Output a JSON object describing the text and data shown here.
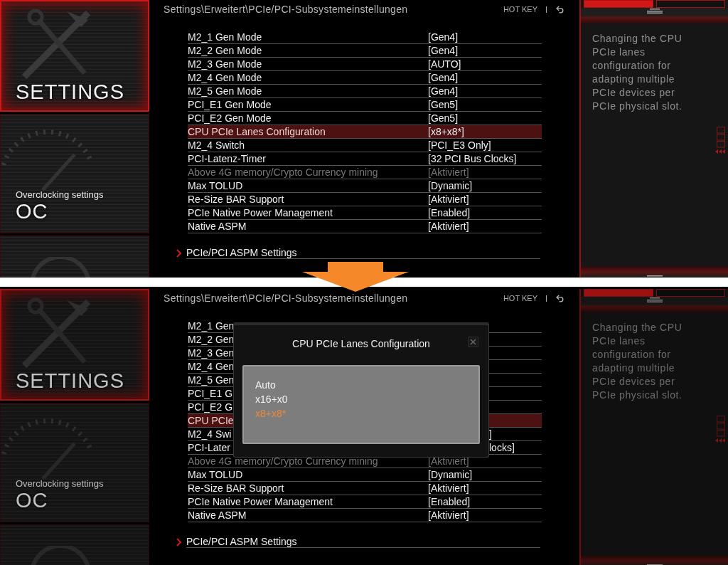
{
  "panels": [
    {
      "dimmed": false,
      "breadcrumb": "Settings\\Erweitert\\PCIe/PCI-Subsystemeinstellungen",
      "hotkey": "HOT KEY",
      "sidebar": [
        {
          "kind": "settings",
          "title": "SETTINGS",
          "selected": true
        },
        {
          "kind": "oc",
          "subtitle": "Overclocking settings",
          "title": "OC",
          "selected": false
        },
        {
          "kind": "blank",
          "selected": false
        }
      ],
      "help_tabs": [
        {
          "selected": true
        },
        {
          "selected": false
        }
      ],
      "help_text": "Changing the CPU\nPCIe lanes\nconfiguration for\nadapting multiple\nPCIe devices per\nPCIe physical slot.",
      "rows": [
        {
          "label": "M2_1 Gen Mode",
          "value": "[Gen4]",
          "selected": false,
          "disabled": false
        },
        {
          "label": "M2_2 Gen Mode",
          "value": "[Gen4]",
          "selected": false,
          "disabled": false
        },
        {
          "label": "M2_3 Gen Mode",
          "value": "[AUTO]",
          "selected": false,
          "disabled": false
        },
        {
          "label": "M2_4 Gen Mode",
          "value": "[Gen4]",
          "selected": false,
          "disabled": false
        },
        {
          "label": "M2_5 Gen Mode",
          "value": "[Gen4]",
          "selected": false,
          "disabled": false
        },
        {
          "label": "PCI_E1 Gen Mode",
          "value": "[Gen5]",
          "selected": false,
          "disabled": false
        },
        {
          "label": "PCI_E2 Gen Mode",
          "value": "[Gen5]",
          "selected": false,
          "disabled": false
        },
        {
          "label": "CPU PCIe Lanes Configuration",
          "value": "[x8+x8*]",
          "selected": true,
          "disabled": false
        },
        {
          "label": "M2_4 Switch",
          "value": "[PCI_E3 Only]",
          "selected": false,
          "disabled": false
        },
        {
          "label": "PCI-Latenz-Timer",
          "value": "[32 PCI Bus Clocks]",
          "selected": false,
          "disabled": false
        },
        {
          "label": "Above 4G memory/Crypto Currency mining",
          "value": "[Aktiviert]",
          "selected": false,
          "disabled": true
        },
        {
          "label": "Max TOLUD",
          "value": "[Dynamic]",
          "selected": false,
          "disabled": false
        },
        {
          "label": "Re-Size BAR Support",
          "value": "[Aktiviert]",
          "selected": false,
          "disabled": false
        },
        {
          "label": "PCIe Native Power Management",
          "value": "[Enabled]",
          "selected": false,
          "disabled": false
        },
        {
          "label": "Native ASPM",
          "value": "[Aktiviert]",
          "selected": false,
          "disabled": false
        }
      ],
      "submenu": "PCIe/PCI ASPM Settings"
    },
    {
      "dimmed": true,
      "breadcrumb": "Settings\\Erweitert\\PCIe/PCI-Subsystemeinstellungen",
      "hotkey": "HOT KEY",
      "sidebar": [
        {
          "kind": "settings",
          "title": "SETTINGS",
          "selected": true
        },
        {
          "kind": "oc",
          "subtitle": "Overclocking settings",
          "title": "OC",
          "selected": false
        },
        {
          "kind": "blank",
          "selected": false
        }
      ],
      "help_tabs": [
        {
          "selected": true
        },
        {
          "selected": false
        }
      ],
      "help_text": "Changing the CPU\nPCIe lanes\nconfiguration for\nadapting multiple\nPCIe devices per\nPCIe physical slot.",
      "rows": [
        {
          "label": "M2_1 Gen",
          "selected": false,
          "disabled": false
        },
        {
          "label": "M2_2 Gen",
          "selected": false,
          "disabled": false
        },
        {
          "label": "M2_3 Gen",
          "selected": false,
          "disabled": false
        },
        {
          "label": "M2_4 Gen",
          "selected": false,
          "disabled": false
        },
        {
          "label": "M2_5 Gen",
          "selected": false,
          "disabled": false
        },
        {
          "label": "PCI_E1 G",
          "selected": false,
          "disabled": false
        },
        {
          "label": "PCI_E2 G",
          "selected": false,
          "disabled": false
        },
        {
          "label": "CPU PCIe",
          "selected": true,
          "disabled": false
        },
        {
          "label": "M2_4 Swi",
          "tail": "]",
          "selected": false,
          "disabled": false
        },
        {
          "label": "PCI-Later",
          "tail": "locks]",
          "selected": false,
          "disabled": false
        },
        {
          "label": "Above 4G memory/Crypto Currency mining",
          "value": "[Aktiviert]",
          "selected": false,
          "disabled": true
        },
        {
          "label": "Max TOLUD",
          "value": "[Dynamic]",
          "selected": false,
          "disabled": false
        },
        {
          "label": "Re-Size BAR Support",
          "value": "[Aktiviert]",
          "selected": false,
          "disabled": false
        },
        {
          "label": "PCIe Native Power Management",
          "value": "[Enabled]",
          "selected": false,
          "disabled": false
        },
        {
          "label": "Native ASPM",
          "value": "[Aktiviert]",
          "selected": false,
          "disabled": false
        }
      ],
      "submenu": "PCIe/PCI ASPM Settings",
      "dialog": {
        "title": "CPU PCIe Lanes Configuration",
        "options": [
          {
            "label": "Auto",
            "selected": false
          },
          {
            "label": "x16+x0",
            "selected": false
          },
          {
            "label": "x8+x8*",
            "selected": true
          }
        ]
      }
    }
  ]
}
